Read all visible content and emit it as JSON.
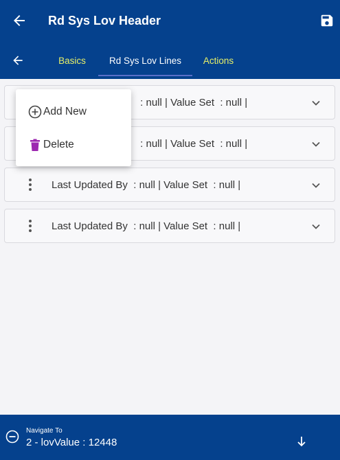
{
  "header": {
    "title": "Rd Sys Lov Header",
    "back_icon": "arrow-left-icon",
    "save_icon": "save-icon"
  },
  "tabs": [
    {
      "label": "Basics",
      "active": false
    },
    {
      "label": "Rd Sys Lov Lines",
      "active": true
    },
    {
      "label": "Actions",
      "active": false
    }
  ],
  "rows": [
    {
      "text": " : null | Value Set  : null |"
    },
    {
      "text": " : null | Value Set  : null |"
    },
    {
      "text": "Last Updated By  : null | Value Set  : null |"
    },
    {
      "text": "Last Updated By  : null | Value Set  : null |"
    }
  ],
  "context_menu": {
    "items": [
      {
        "label": "Add New",
        "icon": "add-circle-icon"
      },
      {
        "label": "Delete",
        "icon": "trash-icon"
      }
    ]
  },
  "footer": {
    "caption": "Navigate To",
    "value": "2 - lovValue : 12448"
  },
  "colors": {
    "primary": "#05418d",
    "tab_inactive": "#e8f067",
    "delete_icon": "#9c27b0"
  }
}
